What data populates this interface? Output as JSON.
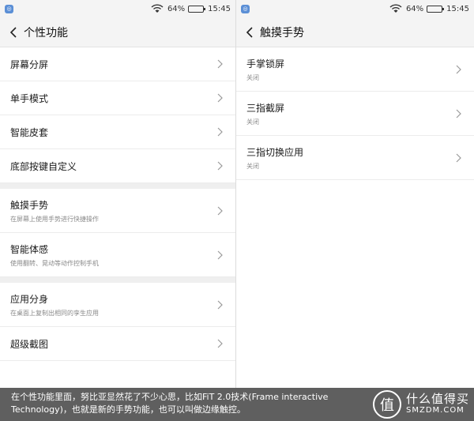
{
  "status": {
    "battery": "64%",
    "time": "15:45",
    "battery_level": 0.64
  },
  "left_screen": {
    "title": "个性功能",
    "groups": [
      [
        {
          "label": "屏幕分屏",
          "sub": ""
        },
        {
          "label": "单手模式",
          "sub": ""
        },
        {
          "label": "智能皮套",
          "sub": ""
        },
        {
          "label": "底部按键自定义",
          "sub": ""
        }
      ],
      [
        {
          "label": "触摸手势",
          "sub": "在屏幕上使用手势进行快捷操作"
        },
        {
          "label": "智能体感",
          "sub": "使用翻转、晃动等动作控制手机"
        }
      ],
      [
        {
          "label": "应用分身",
          "sub": "在桌面上复制出相同的孪生应用"
        },
        {
          "label": "超级截图",
          "sub": ""
        }
      ]
    ]
  },
  "right_screen": {
    "title": "触摸手势",
    "items": [
      {
        "label": "手掌锁屏",
        "sub": "关闭"
      },
      {
        "label": "三指截屏",
        "sub": "关闭"
      },
      {
        "label": "三指切换应用",
        "sub": "关闭"
      }
    ]
  },
  "caption": {
    "text": "在个性功能里面，努比亚显然花了不少心思，比如FiT 2.0技术(Frame interactive Technology)，也就是新的手势功能，也可以叫做边缘触控。",
    "watermark_badge": "值",
    "watermark_title": "什么值得买",
    "watermark_domain": "SMZDM.COM"
  }
}
